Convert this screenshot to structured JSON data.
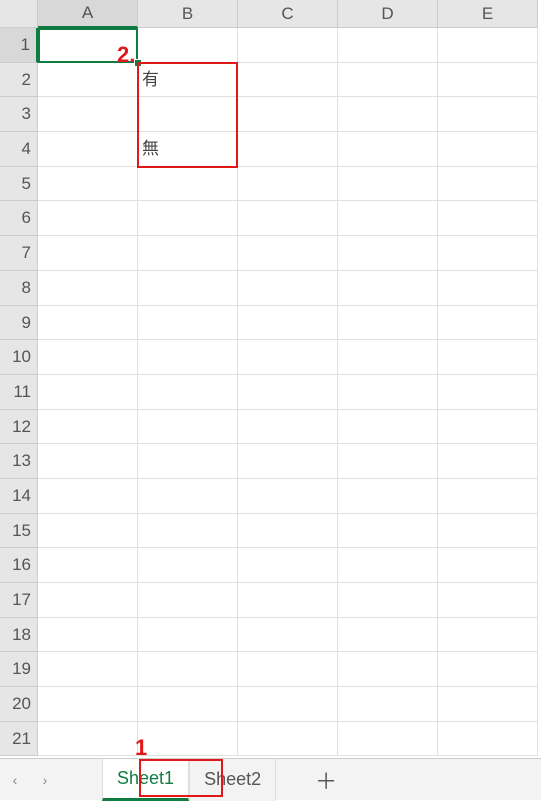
{
  "columns": [
    "A",
    "B",
    "C",
    "D",
    "E"
  ],
  "rows": [
    "1",
    "2",
    "3",
    "4",
    "5",
    "6",
    "7",
    "8",
    "9",
    "10",
    "11",
    "12",
    "13",
    "14",
    "15",
    "16",
    "17",
    "18",
    "19",
    "20",
    "21"
  ],
  "active_col_index": 0,
  "active_row_index": 0,
  "cells": {
    "B2": "有",
    "B4": "無"
  },
  "tabs": {
    "items": [
      "Sheet1",
      "Sheet2"
    ],
    "active_index": 0,
    "add_label": "＋"
  },
  "nav": {
    "prev": "‹",
    "next": "›"
  },
  "annotations": {
    "label1": "1",
    "label2": "2."
  }
}
